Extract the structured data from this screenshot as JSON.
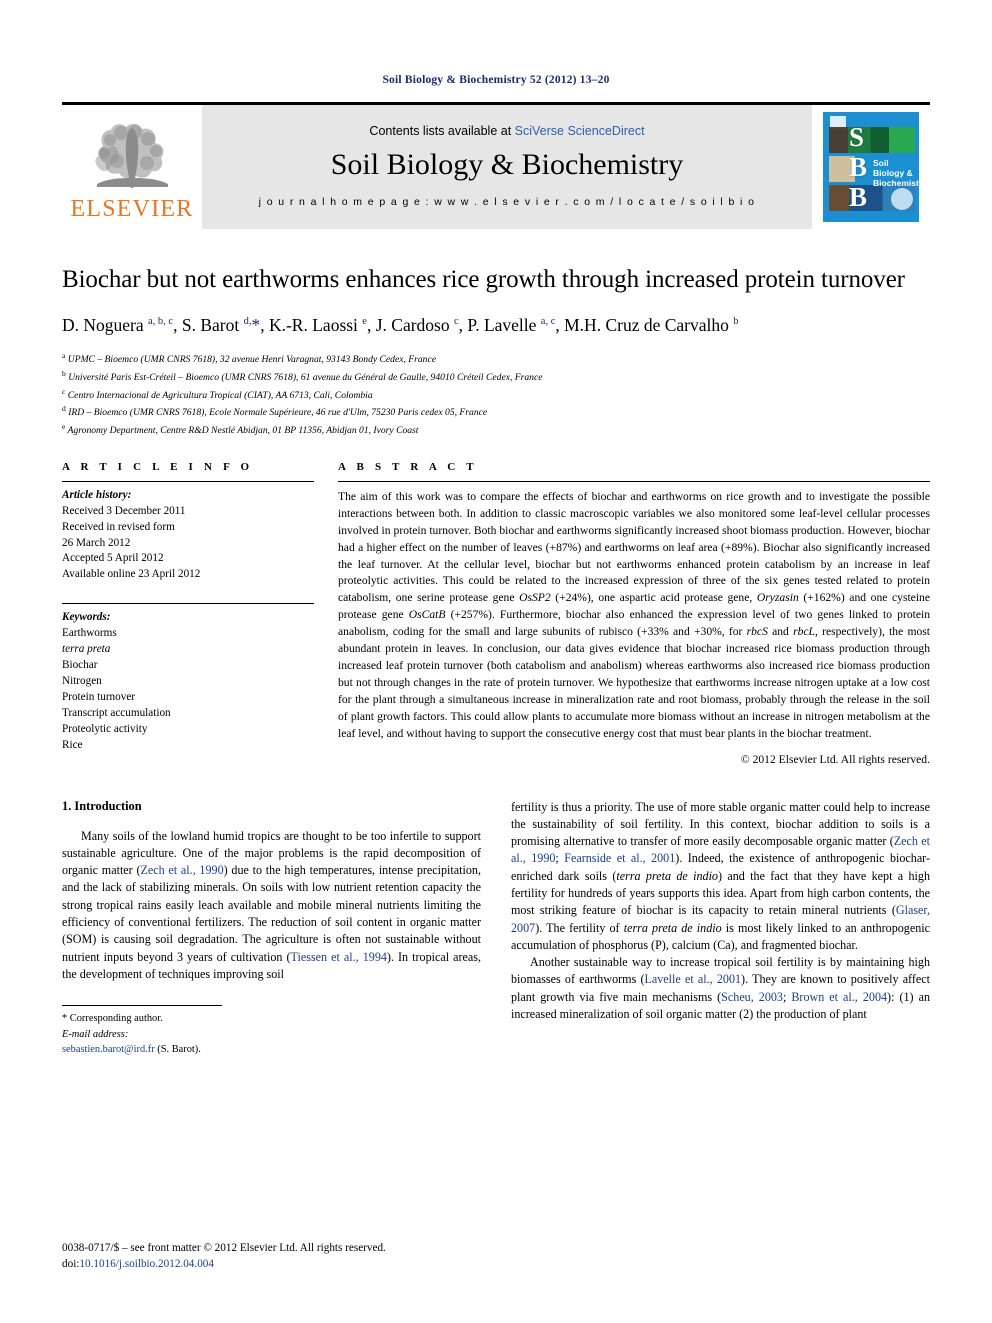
{
  "running_head": "Soil Biology & Biochemistry 52 (2012) 13–20",
  "masthead": {
    "publisher_name": "ELSEVIER",
    "contents_prefix": "Contents lists available at ",
    "contents_link": "SciVerse ScienceDirect",
    "journal_title": "Soil Biology & Biochemistry",
    "homepage": "j o u r n a l   h o m e p a g e :   w w w . e l s e v i e r . c o m / l o c a t e / s o i l b i o",
    "cover": {
      "letters": "S\nB\nB",
      "title": "Soil Biology & Biochemistry"
    }
  },
  "article": {
    "title": "Biochar but not earthworms enhances rice growth through increased protein turnover",
    "authors_html": "D. Noguera <sup>a, b, c</sup>, S. Barot <sup>d,</sup><span class=\"star\">*</span>, K.-R. Laossi <sup>e</sup>, J. Cardoso <sup>c</sup>, P. Lavelle <sup>a, c</sup>, M.H. Cruz de Carvalho <sup>b</sup>",
    "affiliations": [
      {
        "label": "a",
        "text": "UPMC – Bioemco (UMR CNRS 7618), 32 avenue Henri Varagnat, 93143 Bondy Cedex, France"
      },
      {
        "label": "b",
        "text": "Université Paris Est-Créteil – Bioemco (UMR CNRS 7618), 61 avenue du Général de Gaulle, 94010 Créteil Cedex, France"
      },
      {
        "label": "c",
        "text": "Centro Internacional de Agricultura Tropical (CIAT), AA 6713, Cali, Colombia"
      },
      {
        "label": "d",
        "text": "IRD – Bioemco (UMR CNRS 7618), Ecole Normale Supérieure, 46 rue d'Ulm, 75230 Paris cedex 05, France"
      },
      {
        "label": "e",
        "text": "Agronomy Department, Centre R&D Nestlé Abidjan, 01 BP 11356, Abidjan 01, Ivory Coast"
      }
    ]
  },
  "article_info": {
    "heading": "A R T I C L E   I N F O",
    "history_label": "Article history:",
    "history": [
      "Received 3 December 2011",
      "Received in revised form",
      "26 March 2012",
      "Accepted 5 April 2012",
      "Available online 23 April 2012"
    ],
    "keywords_label": "Keywords:",
    "keywords": [
      {
        "text": "Earthworms",
        "italic": false
      },
      {
        "text": "terra preta",
        "italic": true
      },
      {
        "text": "Biochar",
        "italic": false
      },
      {
        "text": "Nitrogen",
        "italic": false
      },
      {
        "text": "Protein turnover",
        "italic": false
      },
      {
        "text": "Transcript accumulation",
        "italic": false
      },
      {
        "text": "Proteolytic activity",
        "italic": false
      },
      {
        "text": "Rice",
        "italic": false
      }
    ]
  },
  "abstract": {
    "heading": "A B S T R A C T",
    "body_html": "The aim of this work was to compare the effects of biochar and earthworms on rice growth and to investigate the possible interactions between both. In addition to classic macroscopic variables we also monitored some leaf-level cellular processes involved in protein turnover. Both biochar and earthworms significantly increased shoot biomass production. However, biochar had a higher effect on the number of leaves (+87%) and earthworms on leaf area (+89%). Biochar also significantly increased the leaf turnover. At the cellular level, biochar but not earthworms enhanced protein catabolism by an increase in leaf proteolytic activities. This could be related to the increased expression of three of the six genes tested related to protein catabolism, one serine protease gene <i>OsSP2</i> (+24%), one aspartic acid protease gene, <i>Oryzasin</i> (+162%) and one cysteine protease gene <i>OsCatB</i> (+257%). Furthermore, biochar also enhanced the expression level of two genes linked to protein anabolism, coding for the small and large subunits of rubisco (+33% and +30%, for <i>rbcS</i> and <i>rbcL</i>, respectively), the most abundant protein in leaves. In conclusion, our data gives evidence that biochar increased rice biomass production through increased leaf protein turnover (both catabolism and anabolism) whereas earthworms also increased rice biomass production but not through changes in the rate of protein turnover. We hypothesize that earthworms increase nitrogen uptake at a low cost for the plant through a simultaneous increase in mineralization rate and root biomass, probably through the release in the soil of plant growth factors. This could allow plants to accumulate more biomass without an increase in nitrogen metabolism at the leaf level, and without having to support the consecutive energy cost that must bear plants in the biochar treatment.",
    "copyright": "© 2012 Elsevier Ltd. All rights reserved."
  },
  "introduction": {
    "heading": "1. Introduction",
    "left_html": "Many soils of the lowland humid tropics are thought to be too infertile to support sustainable agriculture. One of the major problems is the rapid decomposition of organic matter (<span class=\"ref\">Zech et al., 1990</span>) due to the high temperatures, intense precipitation, and the lack of stabilizing minerals. On soils with low nutrient retention capacity the strong tropical rains easily leach available and mobile mineral nutrients limiting the efficiency of conventional fertilizers. The reduction of soil content in organic matter (SOM) is causing soil degradation. The agriculture is often not sustainable without nutrient inputs beyond 3 years of cultivation (<span class=\"ref\">Tiessen et al., 1994</span>). In tropical areas, the development of techniques improving soil",
    "right_html_1": "fertility is thus a priority. The use of more stable organic matter could help to increase the sustainability of soil fertility. In this context, biochar addition to soils is a promising alternative to transfer of more easily decomposable organic matter (<span class=\"ref\">Zech et al., 1990</span>; <span class=\"ref\">Fearnside et al., 2001</span>). Indeed, the existence of anthropogenic biochar-enriched dark soils (<i>terra preta de indio</i>) and the fact that they have kept a high fertility for hundreds of years supports this idea. Apart from high carbon contents, the most striking feature of biochar is its capacity to retain mineral nutrients (<span class=\"ref\">Glaser, 2007</span>). The fertility of <i>terra preta de indio</i> is most likely linked to an anthropogenic accumulation of phosphorus (P), calcium (Ca), and fragmented biochar.",
    "right_html_2": "Another sustainable way to increase tropical soil fertility is by maintaining high biomasses of earthworms (<span class=\"ref\">Lavelle et al., 2001</span>). They are known to positively affect plant growth via five main mechanisms (<span class=\"ref\">Scheu, 2003</span>; <span class=\"ref\">Brown et al., 2004</span>): (1) an increased mineralization of soil organic matter (2) the production of plant"
  },
  "footnote": {
    "corresponding": "* Corresponding author.",
    "email_label": "E-mail address:",
    "email": "sebastien.barot@ird.fr",
    "email_suffix": " (S. Barot)."
  },
  "footer": {
    "issn_line": "0038-0717/$ – see front matter © 2012 Elsevier Ltd. All rights reserved.",
    "doi_label": "doi:",
    "doi": "10.1016/j.soilbio.2012.04.004"
  },
  "colors": {
    "link_blue": "#2b5fb0",
    "ref_blue": "#1a3f8f",
    "elsevier_orange": "#E87722",
    "cover_blue": "#1b8fd1",
    "masthead_grey": "#e6e6e6"
  }
}
